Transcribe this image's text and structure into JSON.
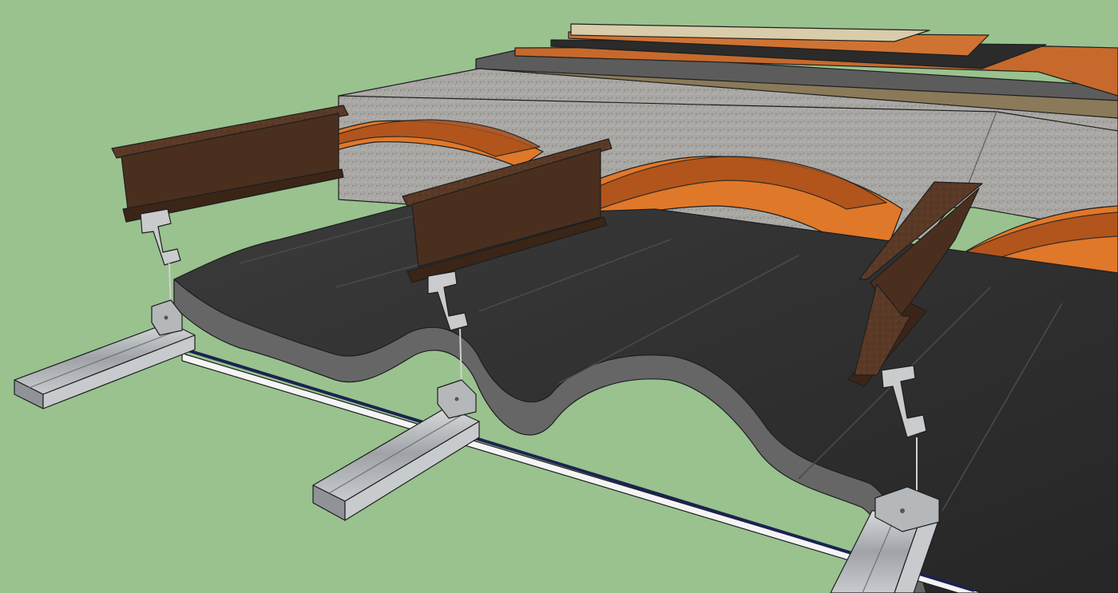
{
  "colors": {
    "background": "#99c28f",
    "concrete": "#a9a7a3",
    "concrete_edge": "#8e8c88",
    "steel_beam": "#5a3a26",
    "steel_beam_dark": "#3b2517",
    "brick_vault": "#e0782a",
    "brick_vault_dark": "#a9501b",
    "insulation": "#2e2e2e",
    "insulation_edge": "#575757",
    "metal_profile": "#b5b8bb",
    "board": "#d8ccaa",
    "wood_layer": "#c7692c",
    "membrane": "#2b2b2b",
    "ceiling_board": "#f4f4f4",
    "ceiling_stripe": "#1a2350"
  },
  "icons": {
    "hanger": "ceiling-hanger-icon",
    "clip": "profile-clip-icon"
  }
}
